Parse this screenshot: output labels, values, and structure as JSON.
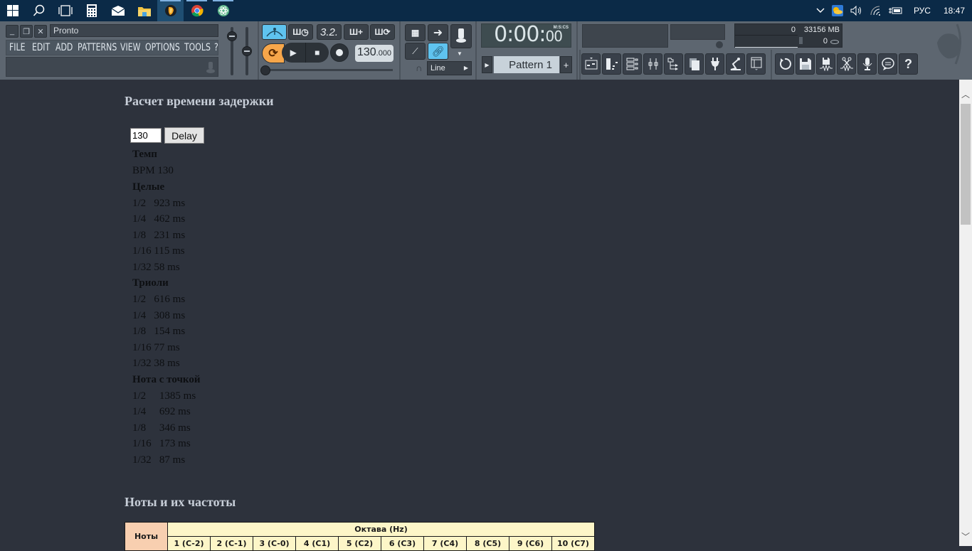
{
  "taskbar": {
    "apps": [
      {
        "name": "start",
        "icon": "windows-logo-icon"
      },
      {
        "name": "search",
        "icon": "search-icon"
      },
      {
        "name": "task-view",
        "icon": "task-view-icon"
      },
      {
        "name": "calculator",
        "icon": "calculator-icon"
      },
      {
        "name": "mail",
        "icon": "mail-icon"
      },
      {
        "name": "file-explorer",
        "icon": "folder-icon"
      },
      {
        "name": "fl-studio",
        "icon": "fl-studio-icon"
      },
      {
        "name": "chrome",
        "icon": "chrome-icon"
      },
      {
        "name": "atom-app",
        "icon": "atom-icon"
      }
    ],
    "tray": {
      "language": "РУС",
      "time": "18:47"
    }
  },
  "fl": {
    "title": "Pronto",
    "menu": [
      "FILE",
      "EDIT",
      "ADD",
      "PATTERNS",
      "VIEW",
      "OPTIONS",
      "TOOLS",
      "?"
    ],
    "tempo_int": "130",
    "tempo_frac": ".000",
    "time_main": "0:00:",
    "time_cs": "00",
    "time_unit": "M:S:CS",
    "pattern": "Pattern 1",
    "snap": "Line",
    "cpu_value": "0",
    "memory": "33156 MB",
    "poly": "0",
    "song_mode_label": "3.2."
  },
  "page": {
    "heading1": "Расчет времени задержки",
    "input_value": "130",
    "delay_button": "Delay",
    "tempo_label": "Темп",
    "bpm_line": "BPM 130",
    "sections": [
      {
        "title": "Целые",
        "rows": [
          "1/2   923 ms",
          "1/4   462 ms",
          "1/8   231 ms",
          "1/16 115 ms",
          "1/32 58 ms"
        ]
      },
      {
        "title": "Триоли",
        "rows": [
          "1/2   616 ms",
          "1/4   308 ms",
          "1/8   154 ms",
          "1/16 77 ms",
          "1/32 38 ms"
        ]
      },
      {
        "title": "Нота с точкой",
        "rows": [
          "1/2     1385 ms",
          "1/4     692 ms",
          "1/8     346 ms",
          "1/16   173 ms",
          "1/32   87 ms"
        ]
      }
    ],
    "heading2": "Ноты и их частоты",
    "table": {
      "notes_header": "Ноты",
      "octave_header": "Октава (Hz)",
      "octaves": [
        "1 (C-2)",
        "2 (C-1)",
        "3 (C-0)",
        "4 (C1)",
        "5 (C2)",
        "6 (C3)",
        "7 (C4)",
        "8 (C5)",
        "9 (C6)",
        "10 (C7)"
      ]
    }
  }
}
